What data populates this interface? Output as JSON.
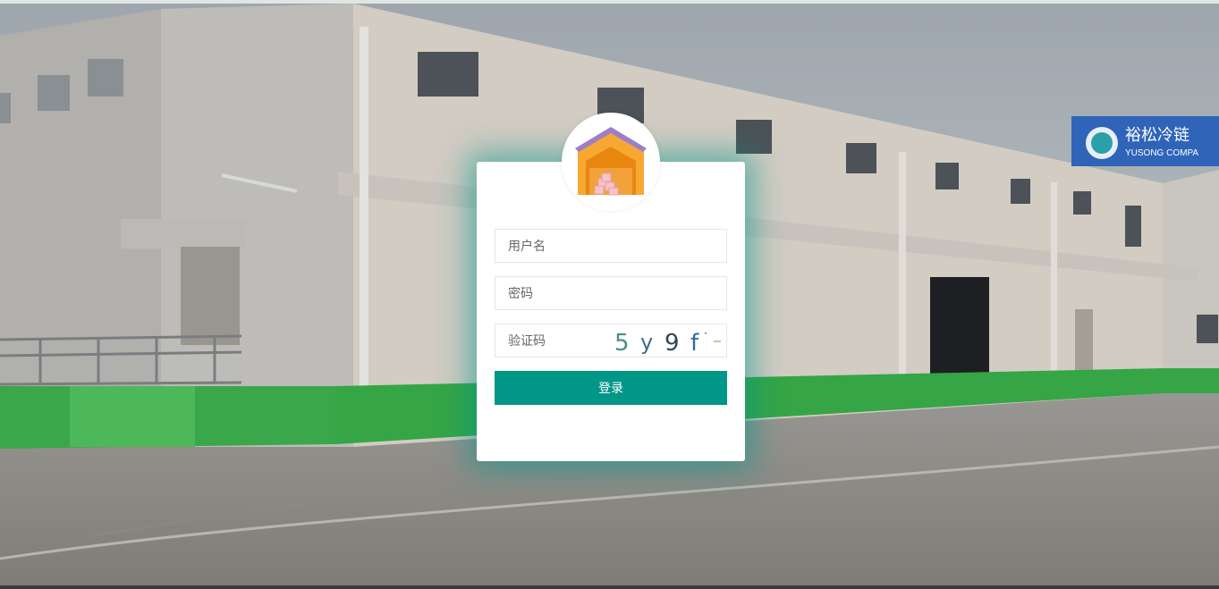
{
  "background": {
    "signboard_text": "裕松冷链",
    "signboard_subtext": "YUSONG COMPA"
  },
  "logo": {
    "icon": "warehouse-icon"
  },
  "form": {
    "username_placeholder": "用户名",
    "password_placeholder": "密码",
    "captcha_placeholder": "验证码",
    "captcha_chars": [
      "5",
      "y",
      "9",
      "f"
    ],
    "login_label": "登录"
  },
  "colors": {
    "primary": "#009688",
    "glow": "#009688",
    "roof": "#9b7fc9",
    "house": "#f5a623",
    "wall_green": "#3aa84a"
  }
}
